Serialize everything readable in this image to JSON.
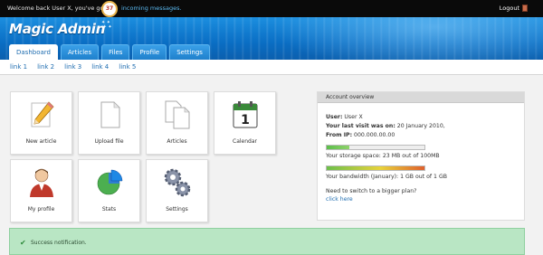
{
  "topbar": {
    "welcome": "Welcome back User X, you've got",
    "message_count": "37",
    "messages_link": "incoming messages.",
    "logout": "Logout"
  },
  "header": {
    "logo": "Magic Admin",
    "tabs": [
      {
        "label": "Dashboard",
        "active": true
      },
      {
        "label": "Articles",
        "active": false
      },
      {
        "label": "Files",
        "active": false
      },
      {
        "label": "Profile",
        "active": false
      },
      {
        "label": "Settings",
        "active": false
      }
    ]
  },
  "subnav": [
    "link 1",
    "link 2",
    "link 3",
    "link 4",
    "link 5"
  ],
  "tiles": [
    {
      "label": "New article",
      "icon": "pencil-icon"
    },
    {
      "label": "Upload file",
      "icon": "document-icon"
    },
    {
      "label": "Articles",
      "icon": "documents-icon"
    },
    {
      "label": "Calendar",
      "icon": "calendar-icon"
    },
    {
      "label": "My profile",
      "icon": "user-icon"
    },
    {
      "label": "Stats",
      "icon": "pie-chart-icon"
    },
    {
      "label": "Settings",
      "icon": "gears-icon"
    }
  ],
  "calendar_day": "1",
  "account": {
    "title": "Account overview",
    "user_label": "User:",
    "user_value": "User X",
    "last_visit_label": "Your last visit was on:",
    "last_visit_value": "20 January 2010,",
    "ip_label": "From IP:",
    "ip_value": "000.000.00.00",
    "storage_text": "Your storage space: 23 MB out of 100MB",
    "storage_fraction": 0.23,
    "bandwidth_text": "Your bandwidth (January): 1 GB out of 1 GB",
    "bandwidth_fraction": 1.0,
    "upgrade_text": "Need to switch to a bigger plan?",
    "upgrade_link": "click here"
  },
  "notification": {
    "text": "Success notification."
  },
  "colors": {
    "header_blue": "#0a6ec4",
    "link_blue": "#1f6db0",
    "success_green": "#b9e6c4"
  }
}
